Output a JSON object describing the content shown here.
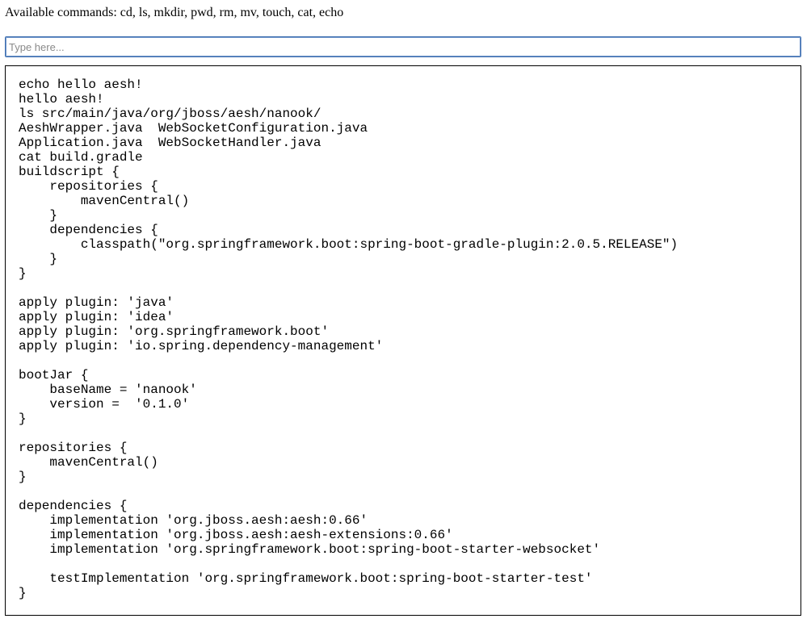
{
  "help": {
    "text": "Available commands: cd, ls, mkdir, pwd, rm, mv, touch, cat, echo"
  },
  "input": {
    "value": "",
    "placeholder": "Type here..."
  },
  "terminal": {
    "lines": [
      "echo hello aesh!",
      "hello aesh!",
      "ls src/main/java/org/jboss/aesh/nanook/",
      "AeshWrapper.java  WebSocketConfiguration.java",
      "Application.java  WebSocketHandler.java",
      "cat build.gradle",
      "buildscript {",
      "    repositories {",
      "        mavenCentral()",
      "    }",
      "    dependencies {",
      "        classpath(\"org.springframework.boot:spring-boot-gradle-plugin:2.0.5.RELEASE\")",
      "    }",
      "}",
      "",
      "apply plugin: 'java'",
      "apply plugin: 'idea'",
      "apply plugin: 'org.springframework.boot'",
      "apply plugin: 'io.spring.dependency-management'",
      "",
      "bootJar {",
      "    baseName = 'nanook'",
      "    version =  '0.1.0'",
      "}",
      "",
      "repositories {",
      "    mavenCentral()",
      "}",
      "",
      "dependencies {",
      "    implementation 'org.jboss.aesh:aesh:0.66'",
      "    implementation 'org.jboss.aesh:aesh-extensions:0.66'",
      "    implementation 'org.springframework.boot:spring-boot-starter-websocket'",
      "",
      "    testImplementation 'org.springframework.boot:spring-boot-starter-test'",
      "}"
    ]
  }
}
